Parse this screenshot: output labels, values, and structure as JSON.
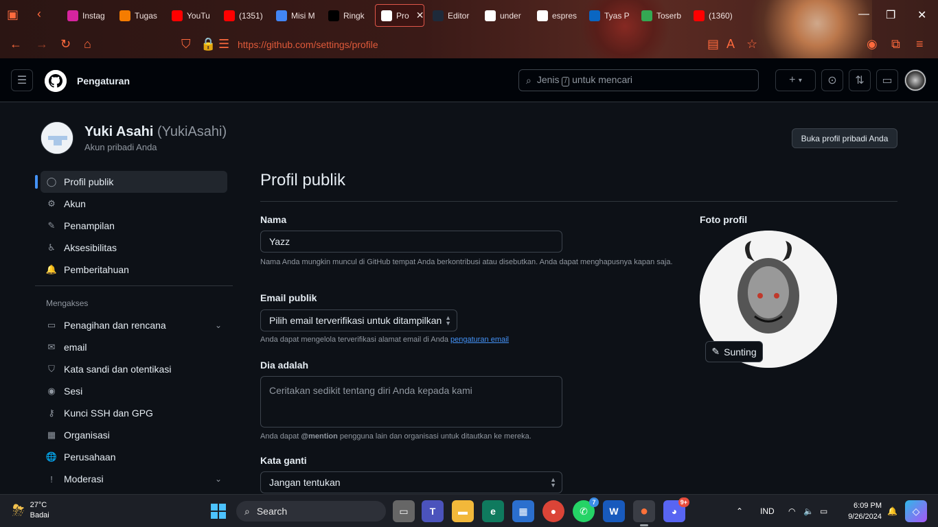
{
  "browser": {
    "tabs": [
      {
        "label": "Instag",
        "icon": "instagram-icon",
        "color": "#d6249f"
      },
      {
        "label": "Tugas",
        "icon": "tasks-icon",
        "color": "#f57c00"
      },
      {
        "label": "YouTu",
        "icon": "youtube-icon",
        "color": "#ff0000"
      },
      {
        "label": "(1351)",
        "icon": "youtube-icon",
        "color": "#ff0000"
      },
      {
        "label": "Misi M",
        "icon": "docs-icon",
        "color": "#4285f4"
      },
      {
        "label": "Ringk",
        "icon": "mk-icon",
        "color": "#000000"
      },
      {
        "label": "Pro",
        "icon": "github-icon",
        "color": "#ffffff"
      },
      {
        "label": "Editor",
        "icon": "d-icon",
        "color": "#1e2a3a"
      },
      {
        "label": "under",
        "icon": "google-icon",
        "color": "#ffffff"
      },
      {
        "label": "espres",
        "icon": "github-icon",
        "color": "#ffffff"
      },
      {
        "label": "Tyas P",
        "icon": "linkedin-icon",
        "color": "#0a66c2"
      },
      {
        "label": "Toserb",
        "icon": "maps-icon",
        "color": "#34a853"
      },
      {
        "label": "(1360)",
        "icon": "youtube-icon",
        "color": "#ff0000"
      }
    ],
    "url": "https://github.com/settings/profile"
  },
  "header": {
    "title": "Pengaturan",
    "search_placeholder_pre": "Jenis",
    "search_key": "/",
    "search_placeholder_post": "untuk mencari"
  },
  "user": {
    "name": "Yuki Asahi",
    "handle": "(YukiAsahi)",
    "subtitle": "Akun pribadi Anda",
    "profile_button": "Buka profil pribadi Anda"
  },
  "sidebar": {
    "items_top": [
      {
        "label": "Profil publik",
        "icon": "person-icon",
        "glyph": "◯"
      },
      {
        "label": "Akun",
        "icon": "gear-icon",
        "glyph": "⚙"
      },
      {
        "label": "Penampilan",
        "icon": "paintbrush-icon",
        "glyph": "✎"
      },
      {
        "label": "Aksesibilitas",
        "icon": "accessibility-icon",
        "glyph": "♿"
      },
      {
        "label": "Pemberitahuan",
        "icon": "bell-icon",
        "glyph": "🔔"
      }
    ],
    "group_label": "Mengakses",
    "items_access": [
      {
        "label": "Penagihan dan rencana",
        "icon": "credit-card-icon",
        "glyph": "▭"
      },
      {
        "label": "email",
        "icon": "mail-icon",
        "glyph": "✉"
      },
      {
        "label": "Kata sandi dan otentikasi",
        "icon": "shield-icon",
        "glyph": "⛉"
      },
      {
        "label": "Sesi",
        "icon": "broadcast-icon",
        "glyph": "◉"
      },
      {
        "label": "Kunci SSH dan GPG",
        "icon": "key-icon",
        "glyph": "⚷"
      },
      {
        "label": "Organisasi",
        "icon": "organization-icon",
        "glyph": "▦"
      },
      {
        "label": "Perusahaan",
        "icon": "globe-icon",
        "glyph": "🌐"
      },
      {
        "label": "Moderasi",
        "icon": "report-icon",
        "glyph": "!"
      }
    ]
  },
  "form": {
    "page_title": "Profil publik",
    "name_label": "Nama",
    "name_value": "Yazz",
    "name_hint": "Nama Anda mungkin muncul di GitHub tempat Anda berkontribusi atau disebutkan. Anda dapat menghapusnya kapan saja.",
    "email_label": "Email publik",
    "email_value": "Pilih email terverifikasi untuk ditampilkan",
    "email_hint_pre": "Anda dapat mengelola terverifikasi alamat email di Anda",
    "email_hint_link": "pengaturan email",
    "bio_label": "Dia adalah",
    "bio_placeholder": "Ceritakan sedikit tentang diri Anda kepada kami",
    "bio_hint_pre": "Anda dapat",
    "bio_hint_mention": "@mention",
    "bio_hint_post": "pengguna lain dan organisasi untuk ditautkan ke mereka.",
    "pronouns_label": "Kata ganti",
    "pronouns_value": "Jangan tentukan",
    "photo_label": "Foto profil",
    "edit_button": "Sunting"
  },
  "taskbar": {
    "temperature": "27°C",
    "weather": "Badai",
    "search_label": "Search",
    "whatsapp_badge": "7",
    "discord_badge": "9+",
    "lang": "IND",
    "time": "6:09 PM",
    "date": "9/26/2024"
  }
}
